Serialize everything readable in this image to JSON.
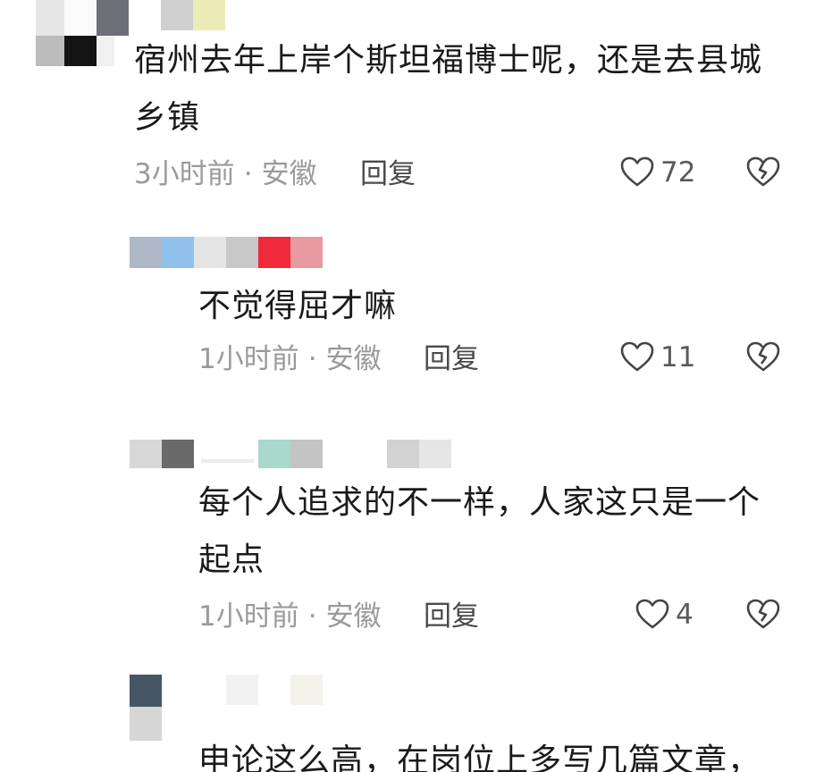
{
  "comments": [
    {
      "text_lines": [
        "宿州去年上岸个斯坦福博士呢，还是去县城",
        "乡镇"
      ],
      "time": "3小时前",
      "location": "安徽",
      "reply_label": "回复",
      "likes": "72",
      "like_icon": "heart-outline-icon",
      "dislike_icon": "broken-heart-icon"
    },
    {
      "text_lines": [
        "不觉得屈才嘛"
      ],
      "time": "1小时前",
      "location": "安徽",
      "reply_label": "回复",
      "likes": "11",
      "like_icon": "heart-outline-icon",
      "dislike_icon": "broken-heart-icon"
    },
    {
      "text_lines": [
        "每个人追求的不一样，人家这只是一个",
        "起点"
      ],
      "time": "1小时前",
      "location": "安徽",
      "reply_label": "回复",
      "likes": "4",
      "like_icon": "heart-outline-icon",
      "dislike_icon": "broken-heart-icon"
    },
    {
      "text_lines": [
        "申论这么高，在岗位上多写几篇文章，"
      ],
      "time": "",
      "location": "",
      "reply_label": "",
      "likes": ""
    }
  ],
  "separator": "·",
  "colors": {
    "text": "#1a1a1a",
    "meta": "#9a9a9a",
    "reply": "#4a4a4a",
    "icon": "#444444"
  }
}
